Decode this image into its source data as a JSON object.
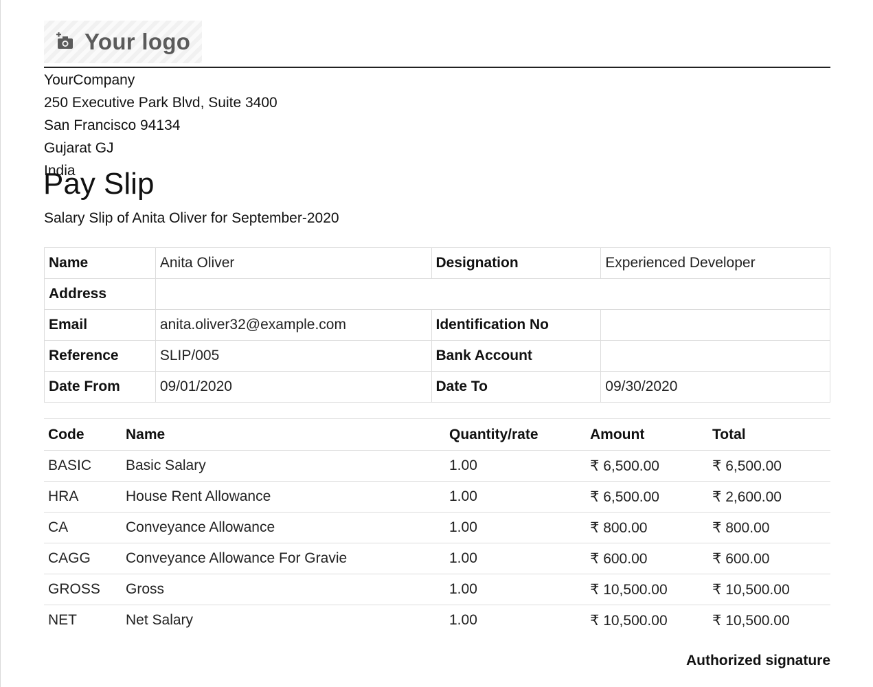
{
  "logo": {
    "text": "Your logo",
    "icon": "camera-add-icon"
  },
  "company": {
    "lines": [
      "YourCompany",
      "250 Executive Park Blvd, Suite 3400",
      "San Francisco 94134",
      "Gujarat GJ",
      "India"
    ]
  },
  "document": {
    "title": "Pay Slip",
    "subtitle": "Salary Slip of Anita Oliver for September-2020"
  },
  "employee": {
    "name_label": "Name",
    "name": "Anita Oliver",
    "designation_label": "Designation",
    "designation": "Experienced Developer",
    "address_label": "Address",
    "address": "",
    "email_label": "Email",
    "email": "anita.oliver32@example.com",
    "identification_label": "Identification No",
    "identification": "",
    "reference_label": "Reference",
    "reference": "SLIP/005",
    "bank_label": "Bank Account",
    "bank": "",
    "date_from_label": "Date From",
    "date_from": "09/01/2020",
    "date_to_label": "Date To",
    "date_to": "09/30/2020"
  },
  "lines": {
    "headers": [
      "Code",
      "Name",
      "Quantity/rate",
      "Amount",
      "Total"
    ],
    "rows": [
      {
        "code": "BASIC",
        "name": "Basic Salary",
        "qty": "1.00",
        "amount": "₹ 6,500.00",
        "total": "₹ 6,500.00"
      },
      {
        "code": "HRA",
        "name": "House Rent Allowance",
        "qty": "1.00",
        "amount": "₹ 6,500.00",
        "total": "₹ 2,600.00"
      },
      {
        "code": "CA",
        "name": "Conveyance Allowance",
        "qty": "1.00",
        "amount": "₹ 800.00",
        "total": "₹ 800.00"
      },
      {
        "code": "CAGG",
        "name": "Conveyance Allowance For Gravie",
        "qty": "1.00",
        "amount": "₹ 600.00",
        "total": "₹ 600.00"
      },
      {
        "code": "GROSS",
        "name": "Gross",
        "qty": "1.00",
        "amount": "₹ 10,500.00",
        "total": "₹ 10,500.00"
      },
      {
        "code": "NET",
        "name": "Net Salary",
        "qty": "1.00",
        "amount": "₹ 10,500.00",
        "total": "₹ 10,500.00"
      }
    ]
  },
  "signature": {
    "label": "Authorized signature"
  }
}
